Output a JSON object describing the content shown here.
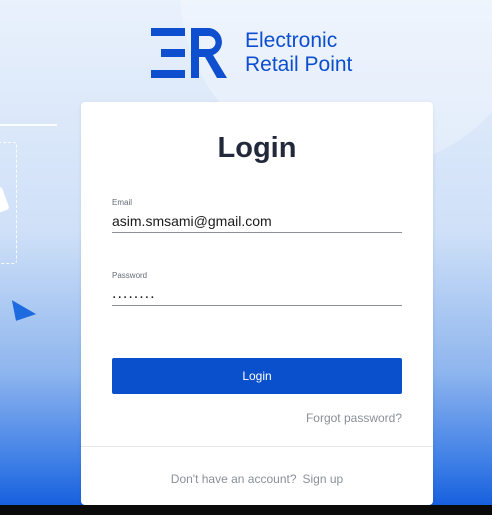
{
  "brand": {
    "logo_icon": "er-logo-icon",
    "name_line1": "Electronic",
    "name_line2": "Retail Point",
    "color": "#0d4fcf"
  },
  "login": {
    "title": "Login",
    "email_label": "Email",
    "email_value": "asim.smsami@gmail.com",
    "password_label": "Password",
    "password_value": "........",
    "button_label": "Login",
    "button_color": "#0a4fcb",
    "forgot_label": "Forgot password?",
    "no_account_text": "Don't have an account?",
    "signup_label": "Sign up"
  }
}
